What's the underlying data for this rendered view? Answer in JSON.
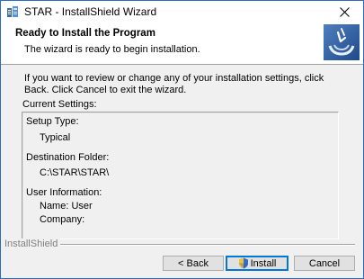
{
  "window": {
    "title": "STAR - InstallShield Wizard"
  },
  "header": {
    "title": "Ready to Install the Program",
    "subtitle": "The wizard is ready to begin installation."
  },
  "content": {
    "intro": "If you want to review or change any of your installation settings, click Back. Click Cancel to exit the wizard.",
    "current_settings_label": "Current Settings:",
    "settings": {
      "setup_type_label": "Setup Type:",
      "setup_type_value": "Typical",
      "destination_label": "Destination Folder:",
      "destination_value": "C:\\STAR\\STAR\\",
      "user_info_label": "User Information:",
      "name_line": "Name: User",
      "company_line": "Company:"
    }
  },
  "footer": {
    "brand": "InstallShield",
    "back_label": "< Back",
    "install_label": "Install",
    "cancel_label": "Cancel"
  },
  "icons": {
    "app": "installer-app-icon",
    "close": "close-icon",
    "logo": "installshield-logo-icon",
    "shield": "uac-shield-icon"
  },
  "colors": {
    "window_border": "#2b6cc4",
    "logo_bg": "#2e5a9c",
    "default_button_border": "#0078d7"
  }
}
